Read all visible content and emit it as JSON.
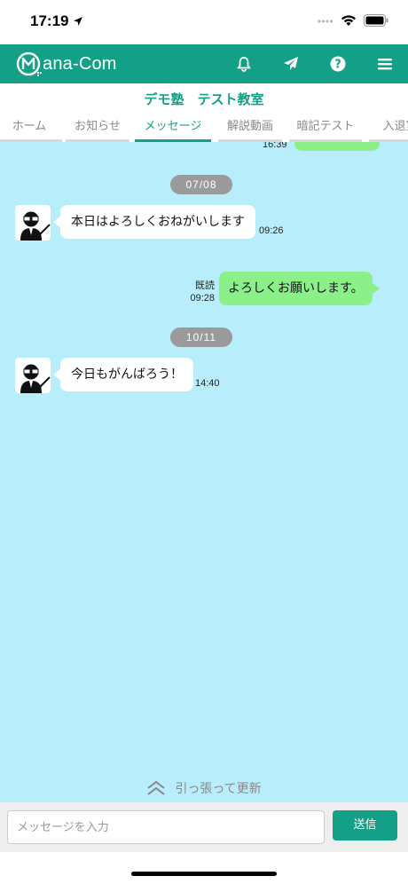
{
  "status_bar": {
    "time": "17:19"
  },
  "header": {
    "logo_text": "ana-Com",
    "icons": [
      "bell-icon",
      "send-icon",
      "help-icon",
      "menu-icon"
    ],
    "accent_color": "#13a086"
  },
  "school_title": "デモ塾　テスト教室",
  "tabs": [
    {
      "label": "ホーム",
      "active": false
    },
    {
      "label": "お知らせ",
      "active": false
    },
    {
      "label": "メッセージ",
      "active": true
    },
    {
      "label": "解説動画",
      "active": false
    },
    {
      "label": "暗記テスト",
      "active": false
    },
    {
      "label": "入退室",
      "active": false
    }
  ],
  "chat": {
    "background": "#b8eefc",
    "partial_top_time": "16:39",
    "groups": [
      {
        "date": "07/08",
        "messages": [
          {
            "direction": "in",
            "text": "本日はよろしくおねがいします",
            "time": "09:26"
          },
          {
            "direction": "out",
            "text": "よろしくお願いします。",
            "time": "09:28",
            "read_label": "既読"
          }
        ]
      },
      {
        "date": "10/11",
        "messages": [
          {
            "direction": "in",
            "text": "今日もがんばろう！",
            "time": "14:40"
          }
        ]
      }
    ],
    "pull_to_refresh": "引っ張って更新"
  },
  "composer": {
    "placeholder": "メッセージを入力",
    "value": "",
    "send_label": "送信"
  }
}
